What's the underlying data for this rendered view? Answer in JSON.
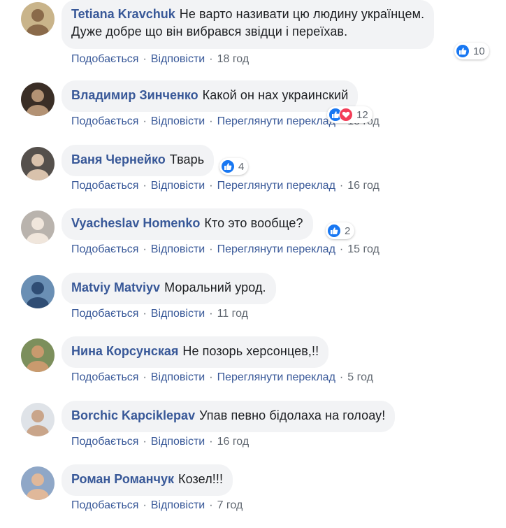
{
  "comments": [
    {
      "author": "Tetiana Kravchuk",
      "lines": [
        "Не варто називати цю людину українцем.",
        "Дуже добре що він вибрався звідци і переїхав."
      ],
      "actions": [
        "Подобається",
        "Відповісти"
      ],
      "time": "18 год",
      "reactions": {
        "types": [
          "like"
        ],
        "count": "10"
      }
    },
    {
      "author": "Владимир Зинченко",
      "lines": [
        "Какой он нах украинский"
      ],
      "actions": [
        "Подобається",
        "Відповісти",
        "Переглянути переклад"
      ],
      "time": "18 год",
      "reactions": {
        "types": [
          "like",
          "love"
        ],
        "count": "12"
      }
    },
    {
      "author": "Ваня Чернейко",
      "lines": [
        "Тварь"
      ],
      "actions": [
        "Подобається",
        "Відповісти",
        "Переглянути переклад"
      ],
      "time": "16 год",
      "reactions": {
        "types": [
          "like"
        ],
        "count": "4"
      }
    },
    {
      "author": "Vyacheslav Homenko",
      "lines": [
        "Кто это вообще?"
      ],
      "actions": [
        "Подобається",
        "Відповісти",
        "Переглянути переклад"
      ],
      "time": "15 год",
      "reactions": {
        "types": [
          "like"
        ],
        "count": "2"
      }
    },
    {
      "author": "Matviy Matviyv",
      "lines": [
        "Моральний урод."
      ],
      "actions": [
        "Подобається",
        "Відповісти"
      ],
      "time": "11 год",
      "reactions": null
    },
    {
      "author": "Нина Корсунская",
      "lines": [
        "Не позорь херсонцев,!!"
      ],
      "actions": [
        "Подобається",
        "Відповісти",
        "Переглянути переклад"
      ],
      "time": "5 год",
      "reactions": null
    },
    {
      "author": "Borchic Kapciklepav",
      "lines": [
        "Упав певно бідолаха на голоау!"
      ],
      "actions": [
        "Подобається",
        "Відповісти"
      ],
      "time": "16 год",
      "reactions": null
    },
    {
      "author": "Роман Романчук",
      "lines": [
        "Козел!!!"
      ],
      "actions": [
        "Подобається",
        "Відповісти"
      ],
      "time": "7 год",
      "reactions": null
    }
  ],
  "colors": {
    "author": "#385898",
    "bubble": "#f2f3f5",
    "meta": "#606770",
    "like": "#1877f2",
    "love": "#f33e58"
  },
  "icons": {
    "like": "thumbs-up-icon",
    "love": "heart-icon"
  }
}
